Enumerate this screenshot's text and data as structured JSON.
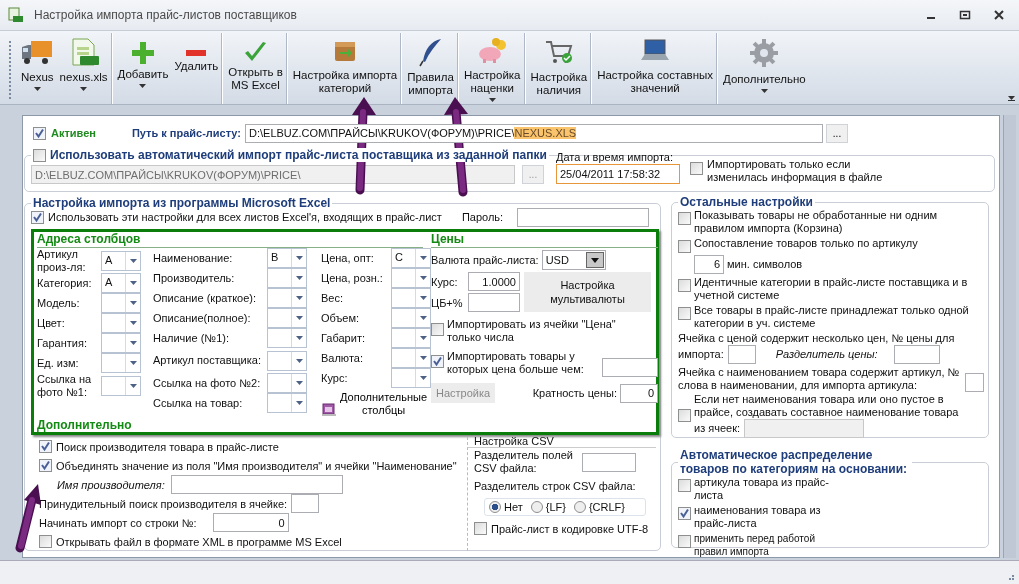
{
  "window": {
    "title": "Настройка импорта прайс-листов поставщиков"
  },
  "toolbar": [
    {
      "label": "Nexus",
      "kind": "truck",
      "dropdown": true,
      "separator": false
    },
    {
      "label": "nexus.xls",
      "kind": "xls",
      "dropdown": true,
      "separator": true
    },
    {
      "label": "Добавить",
      "kind": "plus",
      "dropdown": true,
      "separator": false
    },
    {
      "label": "Удалить",
      "kind": "minus",
      "dropdown": false,
      "separator": true
    },
    {
      "label": "Открыть в\nMS Excel",
      "kind": "check",
      "dropdown": false,
      "separator": true
    },
    {
      "label": "Настройка импорта\nкатегорий",
      "kind": "box",
      "dropdown": false,
      "separator": true
    },
    {
      "label": "Правила\nимпорта",
      "kind": "feather",
      "dropdown": false,
      "separator": true
    },
    {
      "label": "Настройка\nнаценки",
      "kind": "pig",
      "dropdown": true,
      "separator": true
    },
    {
      "label": "Настройка\nналичия",
      "kind": "cart",
      "dropdown": false,
      "separator": true
    },
    {
      "label": "Настройка составных\nзначений",
      "kind": "laptop",
      "dropdown": false,
      "separator": true
    },
    {
      "label": "Дополнительно",
      "kind": "gear",
      "dropdown": true,
      "separator": false
    }
  ],
  "active": {
    "label": "Активен",
    "checked": true
  },
  "path": {
    "label": "Путь к прайс-листу:",
    "folder": "D:\\ELBUZ.COM\\ПРАЙСЫ\\KRUKOV(ФОРУМ)\\PRICE\\",
    "file": "NEXUS.XLS",
    "browse": "..."
  },
  "auto_import": {
    "label": "Использовать автоматический импорт прайс-листа поставщика из заданной папки",
    "checked": false,
    "folder": "D:\\ELBUZ.COM\\ПРАЙСЫ\\KRUKOV(ФОРУМ)\\PRICE\\",
    "browse": "...",
    "disabled": true,
    "date_label": "Дата и время импорта:",
    "date_value": "25/04/2011 17:58:32",
    "only_changed": {
      "label": "Импортировать только если изменилась информация в файле",
      "checked": false
    }
  },
  "excel": {
    "title": "Настройка импорта из программы Microsoft Excel",
    "all_sheets": {
      "label": "Использовать эти настройки для всех листов Excel'я, входящих в прайс-лист",
      "checked": true
    },
    "password_label": "Пароль:",
    "columns_title": "Адреса столбцов",
    "column_groups": [
      {
        "fields": [
          {
            "label": "Артикул произ-ля:",
            "value": "A"
          },
          {
            "label": "Категория:",
            "value": "A"
          },
          {
            "label": "Модель:"
          },
          {
            "label": "Цвет:"
          },
          {
            "label": "Гарантия:"
          },
          {
            "label": "Ед. изм:"
          },
          {
            "label": "Ссылка на фото №1:"
          }
        ]
      },
      {
        "fields": [
          {
            "label": "Наименование:",
            "value": "B"
          },
          {
            "label": "Производитель:"
          },
          {
            "label": "Описание (краткое):"
          },
          {
            "label": "Описание(полное):"
          },
          {
            "label": "Наличие (№1):"
          },
          {
            "label": "Артикул поставщика:"
          },
          {
            "label": "Ссылка на фото №2:"
          },
          {
            "label": "Ссылка на товар:"
          }
        ]
      },
      {
        "fields": [
          {
            "label": "Цена, опт:",
            "value": "C"
          },
          {
            "label": "Цена, розн.:"
          },
          {
            "label": "Вес:"
          },
          {
            "label": "Объем:"
          },
          {
            "label": "Габарит:"
          },
          {
            "label": "Валюта:"
          },
          {
            "label": "Курс:"
          }
        ]
      }
    ],
    "extra_columns": "Дополнительные\nстолбцы",
    "prices": {
      "title": "Цены",
      "currency_label": "Валюта прайс-листа:",
      "currency": "USD",
      "rate_label": "Курс:",
      "rate": "1.0000",
      "cb_label": "ЦБ+%",
      "multi_button": "Настройка\nмультивалюты",
      "only_numbers": {
        "label": "Импортировать из ячейки \"Цена\" только числа",
        "checked": false
      },
      "min_price": {
        "label": "Импортировать товары у которых цена больше чем:",
        "checked": true
      },
      "setup_button": "Настройка",
      "multiplicity_label": "Кратность цены:",
      "multiplicity": "0"
    },
    "extra": {
      "title": "Дополнительно",
      "find_maker": {
        "label": "Поиск производителя товара в прайс-листе",
        "checked": true
      },
      "merge_name": {
        "label": "Объединять значение из поля \"Имя производителя\" и ячейки \"Наименование\"",
        "checked": true
      },
      "maker_name_label": "Имя производителя:",
      "force_search_label": "Принудительный поиск производителя в ячейке:",
      "start_row_label": "Начинать импорт со строки №:",
      "start_row": "0",
      "open_xml": {
        "label": "Открывать файл в формате XML в программе MS Excel",
        "checked": false
      }
    },
    "csv": {
      "title": "Настройка CSV",
      "field_sep_label": "Разделитель полей CSV файла:",
      "row_sep_label": "Разделитель строк CSV файла:",
      "row_sep": [
        {
          "label": "Нет",
          "selected": true
        },
        {
          "label": "{LF}",
          "selected": false
        },
        {
          "label": "{CRLF}",
          "selected": false
        }
      ],
      "utf8": {
        "label": "Прайс-лист в кодировке UTF-8",
        "checked": false
      }
    }
  },
  "other": {
    "title": "Остальные настройки",
    "show_unprocessed": {
      "label": "Показывать товары не обработанные ни одним правилом импорта (Корзина)",
      "checked": false
    },
    "match_by_article": {
      "label": "Сопоставление товаров только по артикулу",
      "checked": false,
      "min_value": "6",
      "min_label": "мин. символов"
    },
    "identical_categories": {
      "label": "Идентичные категории в прайс-листе поставщика и в учетной системе",
      "checked": false
    },
    "single_category": {
      "label": "Все товары в прайс-листе принадлежат только одной категории в уч. системе",
      "checked": false
    },
    "multi_price": {
      "label": "Ячейка с ценой содержит несколько цен, № цены для",
      "label_end": "импорта:",
      "separator_label": "Разделитель цены:"
    },
    "article_in_name": {
      "label": "Ячейка с наименованием товара содержит артикул, № слова в наименовании, для импорта артикула:"
    },
    "compose_name": {
      "label": "Если нет наименования товара или оно пустое в прайсе, создавать составное наименование товара",
      "label_end": "из ячеек:",
      "checked": false
    }
  },
  "auto_category": {
    "title": "Автоматическое распределение товаров по категориям на основании:",
    "options": [
      {
        "label": "артикула товара из прайс-листа",
        "checked": false,
        "kind": "normal"
      },
      {
        "label": "наименования товара из прайс-листа",
        "checked": true,
        "kind": "normal"
      },
      {
        "label": "применить перед работой правил импорта",
        "checked": false,
        "kind": "small"
      }
    ]
  }
}
